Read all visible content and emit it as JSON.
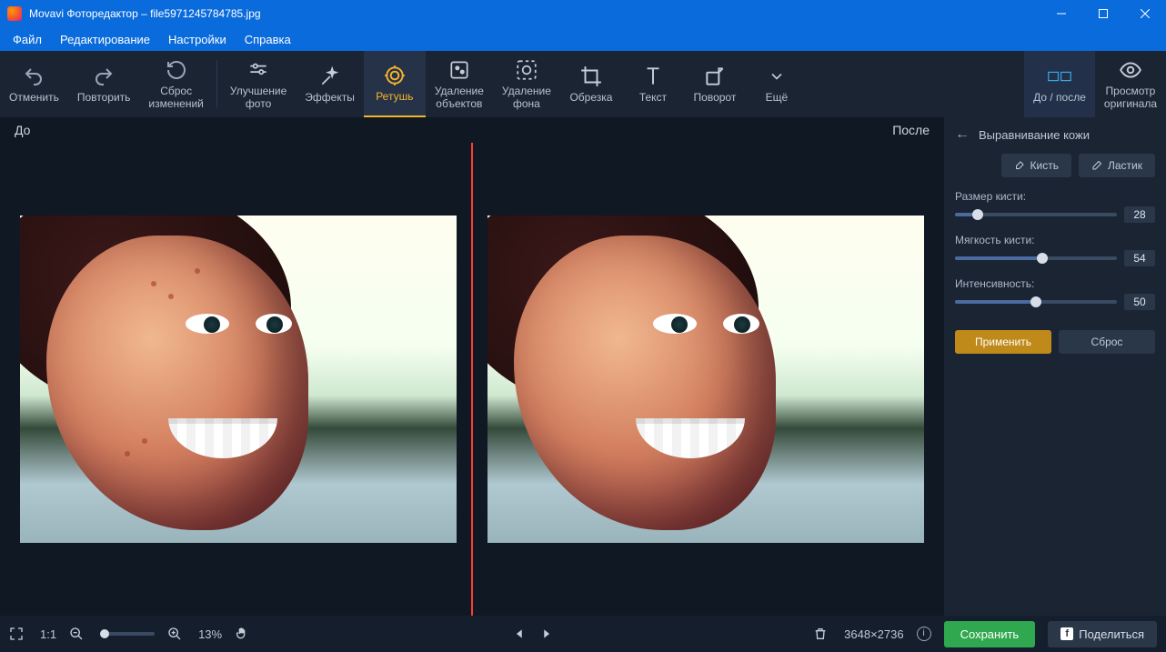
{
  "titlebar": {
    "app": "Movavi Фоторедактор",
    "filename": "file5971245784785.jpg"
  },
  "menu": [
    "Файл",
    "Редактирование",
    "Настройки",
    "Справка"
  ],
  "toolbar": {
    "undo": "Отменить",
    "redo": "Повторить",
    "reset": "Сброс\nизменений",
    "enhance": "Улучшение\nфото",
    "effects": "Эффекты",
    "retouch": "Ретушь",
    "remove_obj": "Удаление\nобъектов",
    "remove_bg": "Удаление\nфона",
    "crop": "Обрезка",
    "text": "Текст",
    "rotate": "Поворот",
    "more": "Ещё",
    "before_after": "До / после",
    "view_original": "Просмотр\nоригинала"
  },
  "canvas": {
    "before_label": "До",
    "after_label": "После"
  },
  "panel": {
    "title": "Выравнивание кожи",
    "tab_brush": "Кисть",
    "tab_eraser": "Ластик",
    "sliders": [
      {
        "label": "Размер кисти:",
        "value": 28,
        "pct": 14
      },
      {
        "label": "Мягкость кисти:",
        "value": 54,
        "pct": 54
      },
      {
        "label": "Интенсивность:",
        "value": 50,
        "pct": 50
      }
    ],
    "apply": "Применить",
    "reset": "Сброс"
  },
  "bottom": {
    "fit_label": "1:1",
    "zoom_pct": "13%",
    "dim": "3648×2736",
    "save": "Сохранить",
    "share": "Поделиться"
  }
}
